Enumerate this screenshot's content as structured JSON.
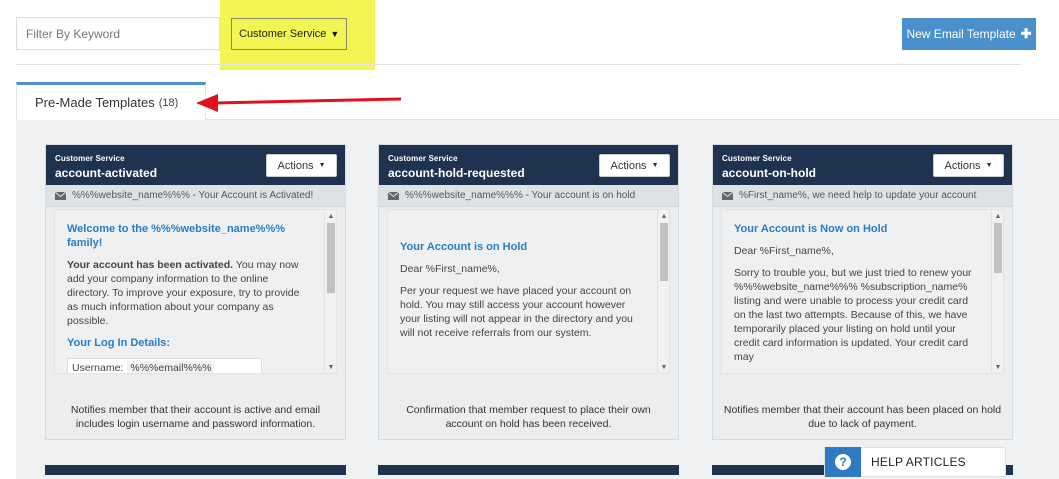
{
  "toolbar": {
    "filter_placeholder": "Filter By Keyword",
    "category_selected": "Customer Service",
    "new_template_label": "New Email Template",
    "highlight_color": "#f3f553",
    "accent_color": "#4a90cc"
  },
  "tab": {
    "label": "Pre-Made Templates",
    "count": "(18)",
    "annotation_arrow_color": "#e0111d"
  },
  "cards": [
    {
      "category": "Customer Service",
      "title": "account-activated",
      "actions_label": "Actions",
      "subject": "%%%website_name%%% - Your Account is Activated!",
      "preview": {
        "heading": "Welcome to the %%%website_name%%% family!",
        "bold_lead": "Your account has been activated.",
        "paragraph": "You may now add your company information to the online directory. To improve your exposure, try to provide as much information about your company as possible.",
        "sub_heading": "Your Log In Details:",
        "field_label": "Username:",
        "field_value": "%%%email%%%"
      },
      "description": "Notifies member that their account is active and email includes login username and password information."
    },
    {
      "category": "Customer Service",
      "title": "account-hold-requested",
      "actions_label": "Actions",
      "subject": "%%%website_name%%% - Your account is on hold",
      "preview": {
        "heading": "Your Account is on Hold",
        "greeting": "Dear %First_name%,",
        "paragraph": "Per your request we have placed your account on hold. You may still access your account however your listing will not appear in the directory and you will not receive referrals from our system."
      },
      "description": "Confirmation that member request to place their own account on hold has been received."
    },
    {
      "category": "Customer Service",
      "title": "account-on-hold",
      "actions_label": "Actions",
      "subject": "%First_name%, we need help to update your account",
      "preview": {
        "heading": "Your Account is Now on Hold",
        "greeting": "Dear %First_name%,",
        "paragraph": "Sorry to trouble you, but we just tried to renew your %%%website_name%%% %subscription_name% listing and were unable to process your credit card on the last two attempts. Because of this, we have temporarily placed your listing on hold until your credit card information is updated. Your credit card may"
      },
      "description": "Notifies member that their account has been placed on hold due to lack of payment."
    }
  ],
  "help": {
    "label": "HELP ARTICLES",
    "icon": "question-icon"
  },
  "colors": {
    "card_header": "#1f3350",
    "preview_link": "#2a7dc4"
  }
}
